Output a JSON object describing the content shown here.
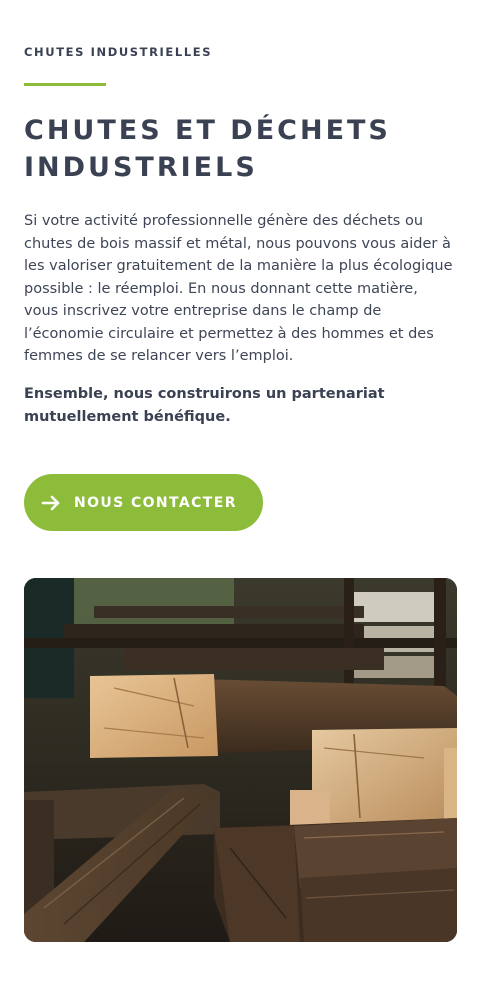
{
  "section": {
    "eyebrow": "CHUTES INDUSTRIELLES",
    "title": "CHUTES ET DÉCHETS INDUSTRIELS",
    "lead": "Si votre activité professionnelle génère des déchets ou chutes de bois massif et métal, nous pouvons vous aider à les valoriser gratuitement de la manière la plus écologique possible : le réemploi. En nous donnant cette matière, vous inscrivez votre entreprise dans le champ de l’économie circulaire et permettez à des hommes et des femmes de se relancer vers l’emploi.",
    "emphasis": "Ensemble, nous construirons un partenariat mutuellement bénéfique."
  },
  "cta": {
    "label": "NOUS CONTACTER",
    "icon": "arrow-right-icon"
  },
  "photo": {
    "subject": "stacked-wood-beams"
  },
  "colors": {
    "accent": "#8dbb3a",
    "text": "#3a4152",
    "background": "#ffffff"
  }
}
